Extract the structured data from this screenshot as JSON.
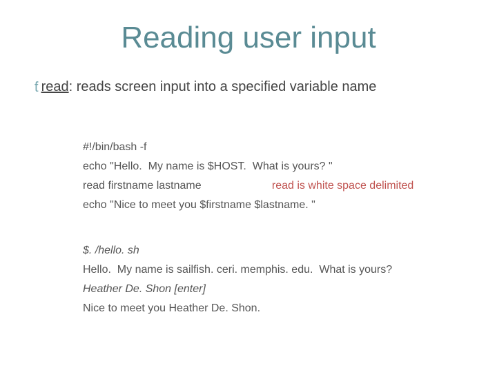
{
  "title": "Reading user input",
  "bullet": {
    "term": "read",
    "desc": ": reads screen input into a specified variable name"
  },
  "code": {
    "line1": "#!/bin/bash -f",
    "line2": "echo \"Hello.  My name is $HOST.  What is yours? \"",
    "line3_cmd": "read firstname lastname",
    "line3_note": "read is white space delimited",
    "line4": "echo \"Nice to meet you $firstname $lastname. \""
  },
  "output": {
    "line1": "$. /hello. sh",
    "line2": "Hello.  My name is sailfish. ceri. memphis. edu.  What is yours?",
    "line3": "Heather De. Shon [enter]",
    "line4": "Nice to meet you Heather De. Shon."
  }
}
